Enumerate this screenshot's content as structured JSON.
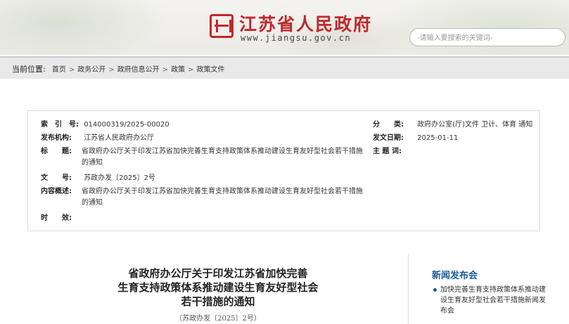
{
  "header": {
    "site_name": "江苏省人民政府",
    "site_url": "www.jiangsu.gov.cn",
    "search_placeholder": "-请输入要搜索的关键词-"
  },
  "breadcrumb": {
    "lead": "当前位置:",
    "items": [
      "首页",
      "政务公开",
      "政府信息公开",
      "政策",
      "政策文件"
    ],
    "separator": ">"
  },
  "meta": {
    "index_label": "索　引　号:",
    "index_value": "014000319/2025-00020",
    "category_label": "分　　类:",
    "category_value": "政府办公室(厅)文件 卫计、体育 通知",
    "issuer_label": "发布机构:",
    "issuer_value": "江苏省人民政府办公厅",
    "date_label": "发文日期:",
    "date_value": "2025-01-11",
    "title_label": "标　　题:",
    "title_value": "省政府办公厅关于印发江苏省加快完善生育支持政策体系推动建设生育友好型社会若干措施的通知",
    "topic_label": "主 题 词:",
    "topic_value": "",
    "docno_label": "文　　号:",
    "docno_value": "苏政办发〔2025〕2号",
    "summary_label": "内容概述:",
    "summary_value": "省政府办公厅关于印发江苏省加快完善生育支持政策体系推动建设生育友好型社会若干措施的通知",
    "validity_label": "时　　效:",
    "validity_value": ""
  },
  "article": {
    "title_line1": "省政府办公厅关于印发江苏省加快完善",
    "title_line2": "生育支持政策体系推动建设生育友好型社会",
    "title_line3": "若干措施的通知",
    "docno": "（苏政办发〔2025〕2号）"
  },
  "sidebar": {
    "heading": "新闻发布会",
    "items": [
      "加快完善生育支持政策体系推动建设生育友好型社会若干措施新闻发布会"
    ]
  },
  "colors": {
    "brand_red": "#c0282b",
    "link_blue": "#1b5b96"
  }
}
